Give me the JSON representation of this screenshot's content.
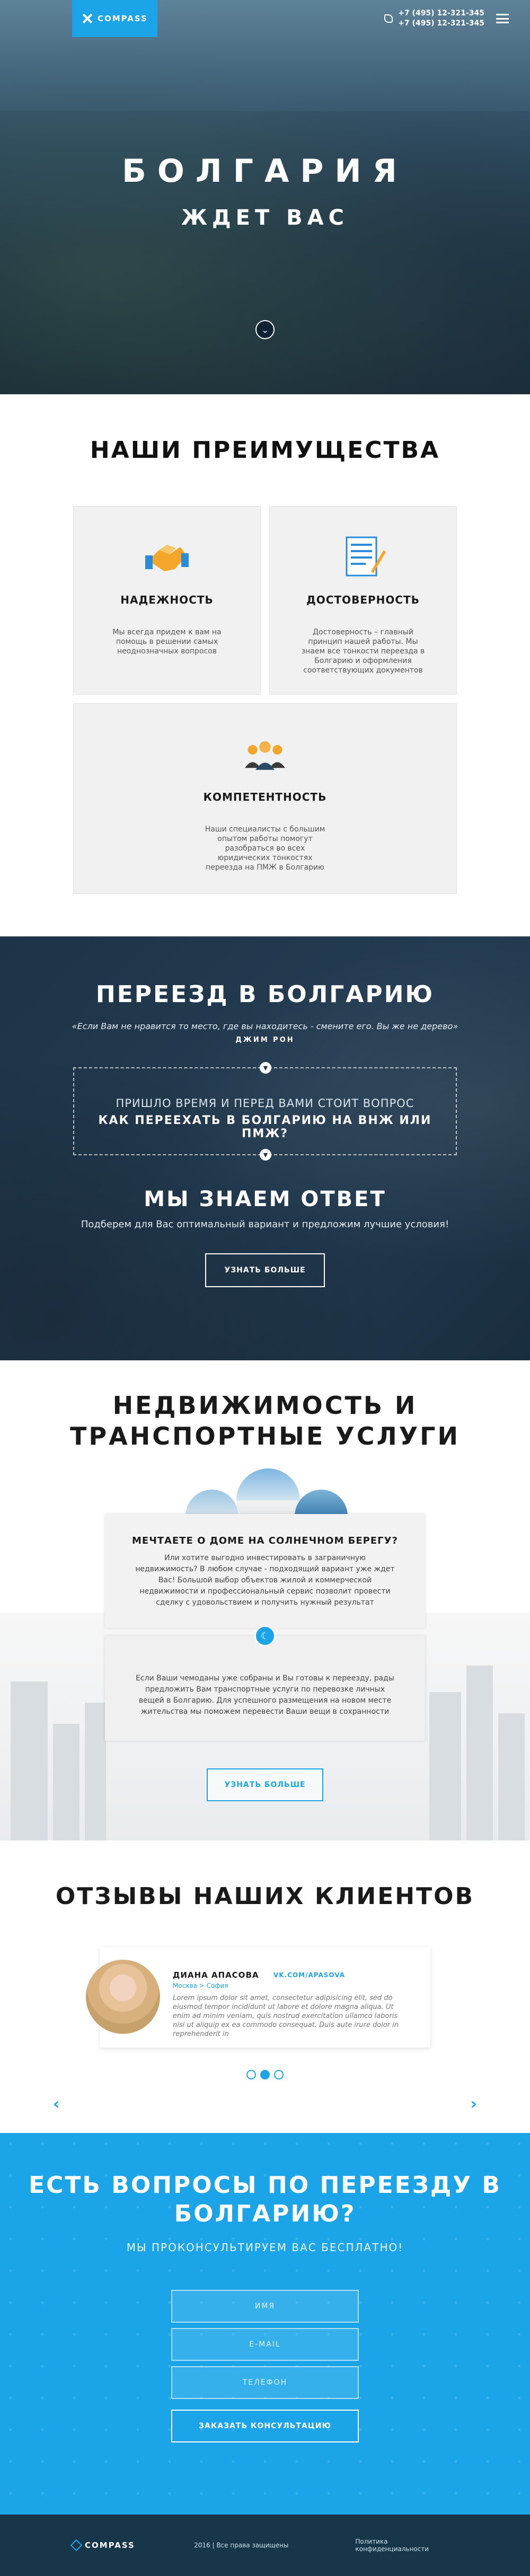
{
  "header": {
    "brand": "COMPASS",
    "phones": [
      "+7 (495) 12-321-345",
      "+7 (495) 12-321-345"
    ]
  },
  "hero": {
    "title": "БОЛГАРИЯ",
    "subtitle": "ЖДЕТ ВАС"
  },
  "advantages": {
    "title": "НАШИ ПРЕИМУЩЕСТВА",
    "items": [
      {
        "title": "НАДЕЖНОСТЬ",
        "text": "Мы всегда придем к вам на помощь в решении самых неоднозначных вопросов",
        "icon": "handshake-icon"
      },
      {
        "title": "ДОСТОВЕРНОСТЬ",
        "text": "Достоверность – главный принцип нашей работы. Мы знаем все тонкости переезда в Болгарию и оформления соответствующих документов",
        "icon": "document-icon"
      },
      {
        "title": "КОМПЕТЕНТНОСТЬ",
        "text": "Наши специалисты с большим опытом работы помогут разобраться во всех юридических тонкостях переезда на ПМЖ в Болгарию",
        "icon": "team-icon"
      }
    ]
  },
  "move": {
    "title": "ПЕРЕЕЗД В БОЛГАРИЮ",
    "quote": "«Если Вам не нравится то место, где вы находитесь - смените его. Вы же не дерево»",
    "author": "ДЖИМ РОН",
    "question_line1": "ПРИШЛО ВРЕМЯ И ПЕРЕД ВАМИ СТОИТ ВОПРОС",
    "question_line2": "КАК ПЕРЕЕХАТЬ В БОЛГАРИЮ НА ВНЖ ИЛИ ПМЖ?",
    "answer_title": "МЫ ЗНАЕМ ОТВЕТ",
    "answer_sub": "Подберем для Вас оптимальный вариант и предложим лучшие условия!",
    "button": "УЗНАТЬ БОЛЬШЕ"
  },
  "estate": {
    "title": "НЕДВИЖИМОСТЬ И ТРАНСПОРТНЫЕ УСЛУГИ",
    "card1_title": "МЕЧТАЕТЕ О ДОМЕ НА СОЛНЕЧНОМ БЕРЕГУ?",
    "card1_text": "Или хотите выгодно инвестировать в заграничную недвижимость? В любом случае - подходящий вариант уже ждет Вас! Большой выбор объектов жилой и коммерческой недвижимости и профессиональный сервис позволит провести сделку с удовольствием и получить нужный результат",
    "card2_text": "Если Ваши чемоданы уже собраны и Вы готовы к переезду, рады предложить Вам транспортные услуги по перевозке личных вещей в Болгарию. Для успешного размещения на новом месте жительства мы поможем перевести Ваши вещи в сохранности",
    "button": "УЗНАТЬ БОЛЬШЕ"
  },
  "reviews": {
    "title": "ОТЗЫВЫ НАШИХ КЛИЕНТОВ",
    "name": "ДИАНА АПАСОВА",
    "vk": "VK.COM/APASOVA",
    "city": "Москва > София",
    "text": "Lorem ipsum dolor sit amet, consectetur adipisicing elit, sed do eiusmod tempor incididunt ut labore et dolore magna aliqua. Ut enim ad minim veniam, quis nostrud exercitation ullamco laboris nisi ut aliquip ex ea commodo consequat. Duis aute irure dolor in reprehenderit in"
  },
  "consult": {
    "title": "ЕСТЬ ВОПРОСЫ ПО ПЕРЕЕЗДУ В БОЛГАРИЮ?",
    "sub": "МЫ ПРОКОНСУЛЬТИРУЕМ ВАС БЕСПЛАТНО!",
    "name_placeholder": "ИМЯ",
    "email_placeholder": "E-MAIL",
    "phone_placeholder": "ТЕЛЕФОН",
    "submit": "ЗАКАЗАТЬ КОНСУЛЬТАЦИЮ"
  },
  "footer": {
    "brand": "COMPASS",
    "copyright": "2016 | Все права защищены",
    "privacy": "Политика конфиденциальности"
  },
  "colors": {
    "accent": "#1ba5e8",
    "dark": "#1d3347"
  }
}
